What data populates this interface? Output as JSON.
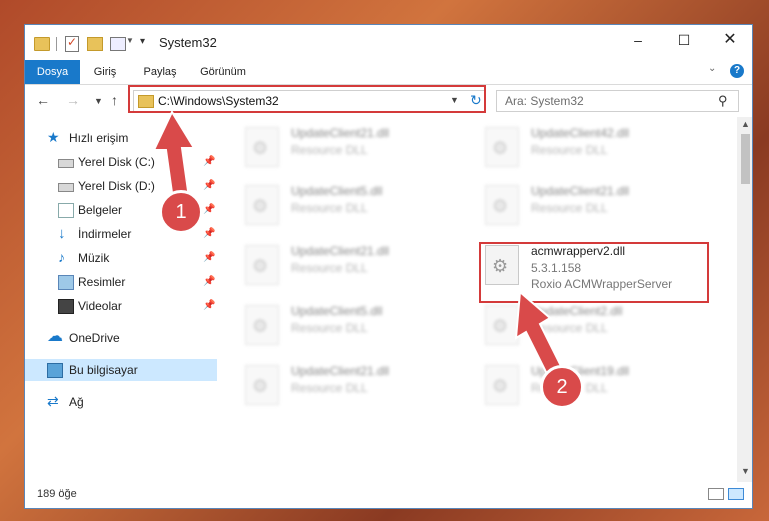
{
  "window": {
    "title": "System32",
    "minimize": "–",
    "maximize": "☐",
    "close": "✕"
  },
  "ribbon": {
    "tabs": [
      "Dosya",
      "Giriş",
      "Paylaş",
      "Görünüm"
    ],
    "help": "?"
  },
  "nav": {
    "address": "C:\\Windows\\System32",
    "search_placeholder": "Ara: System32"
  },
  "sidebar": {
    "items": [
      {
        "label": "Hızlı erişim",
        "icon": "star-icon"
      },
      {
        "label": "Yerel Disk (C:)",
        "icon": "drive-icon",
        "pinned": true
      },
      {
        "label": "Yerel Disk (D:)",
        "icon": "drive-icon",
        "pinned": true
      },
      {
        "label": "Belgeler",
        "icon": "documents-icon",
        "pinned": true
      },
      {
        "label": "İndirmeler",
        "icon": "download-icon",
        "pinned": true
      },
      {
        "label": "Müzik",
        "icon": "music-icon",
        "pinned": true
      },
      {
        "label": "Resimler",
        "icon": "pictures-icon",
        "pinned": true
      },
      {
        "label": "Videolar",
        "icon": "videos-icon",
        "pinned": true
      },
      {
        "label": "OneDrive",
        "icon": "cloud-icon"
      },
      {
        "label": "Bu bilgisayar",
        "icon": "computer-icon",
        "selected": true
      },
      {
        "label": "Ağ",
        "icon": "network-icon"
      }
    ]
  },
  "files": [
    {
      "name": "UpdateClient21.dll",
      "line1": "Resource DLL",
      "line2": ""
    },
    {
      "name": "UpdateClient42.dll",
      "line1": "Resource DLL",
      "line2": ""
    },
    {
      "name": "UpdateClient5.dll",
      "line1": "Resource DLL",
      "line2": ""
    },
    {
      "name": "UpdateClient21.dll",
      "line1": "Resource DLL",
      "line2": ""
    },
    {
      "name": "UpdateClient21.dll",
      "line1": "Resource DLL",
      "line2": ""
    },
    {
      "name": "acmwrapperv2.dll",
      "line1": "5.3.1.158",
      "line2": "Roxio ACMWrapperServer"
    },
    {
      "name": "UpdateClient5.dll",
      "line1": "Resource DLL",
      "line2": ""
    },
    {
      "name": "UpdateClient2.dll",
      "line1": "Resource DLL",
      "line2": ""
    },
    {
      "name": "UpdateClient21.dll",
      "line1": "Resource DLL",
      "line2": ""
    },
    {
      "name": "UpdateClient19.dll",
      "line1": "Resource DLL",
      "line2": ""
    }
  ],
  "status": {
    "count": "189 öğe"
  },
  "annotations": {
    "step1": "1",
    "step2": "2",
    "color": "#d94a4a"
  }
}
